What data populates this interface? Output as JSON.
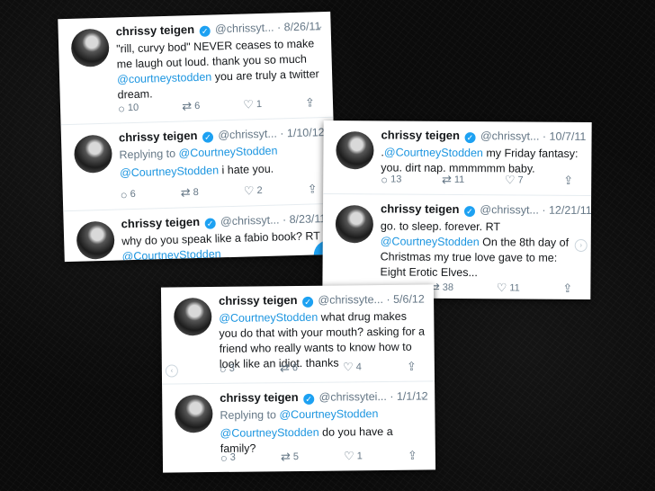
{
  "colors": {
    "accent": "#1da1f2",
    "link": "#1b95e0"
  },
  "card1": {
    "tweets": [
      {
        "name": "chrissy teigen",
        "handle": "@chrissyt...",
        "date": "· 8/26/11",
        "text1": "\"rill, curvy bod\" NEVER ceases to make me laugh out loud. thank you so much ",
        "mention": "@courtneystodden",
        "text2": " you are truly a twitter dream.",
        "replies": "10",
        "retweets": "6",
        "likes": "1"
      },
      {
        "name": "chrissy teigen",
        "handle": "@chrissyt...",
        "date": "· 1/10/12",
        "replying_prefix": "Replying to ",
        "replying_handle": "@CourtneyStodden",
        "mention": "@CourtneyStodden",
        "text2": " i hate you.",
        "replies": "6",
        "retweets": "8",
        "likes": "2"
      },
      {
        "name": "chrissy teigen",
        "handle": "@chrissyt...",
        "date": "· 8/23/11",
        "text1": "why do you speak like a fabio book? RT ",
        "mention": "@CourtneyStodden"
      }
    ]
  },
  "card2": {
    "tweets": [
      {
        "name": "chrissy teigen",
        "handle": "@chrissyt...",
        "date": "· 10/7/11",
        "text1": ".",
        "mention": "@CourtneyStodden",
        "text2": " my Friday fantasy: you. dirt nap. mmmmmm baby.",
        "replies": "13",
        "retweets": "11",
        "likes": "7"
      },
      {
        "name": "chrissy teigen",
        "handle": "@chrissyt...",
        "date": "· 12/21/11",
        "text1": "go. to sleep. forever. RT ",
        "mention": "@CourtneyStodden",
        "text2": " On the 8th day of Christmas my true love gave to me: Eight Erotic Elves...",
        "retweets": "38",
        "likes": "11"
      }
    ]
  },
  "card3": {
    "tweets": [
      {
        "name": "chrissy teigen",
        "handle": "@chrissyte...",
        "date": "· 5/6/12",
        "mention": "@CourtneyStodden",
        "text2": " what drug makes you do that with your mouth? asking for a friend who really wants to know how to look like an idiot. thanks",
        "replies": "3",
        "retweets": "6",
        "likes": "4"
      },
      {
        "name": "chrissy teigen",
        "handle": "@chrissytei...",
        "date": "· 1/1/12",
        "replying_prefix": "Replying to ",
        "replying_handle": "@CourtneyStodden",
        "mention": "@CourtneyStodden",
        "text2": " do you have a family?",
        "replies": "3",
        "retweets": "5",
        "likes": "1"
      }
    ]
  },
  "icons": {
    "reply": "reply-icon",
    "retweet": "retweet-icon",
    "like": "heart-icon",
    "share": "share-icon",
    "verified": "verified-badge-icon",
    "compose": "compose-icon"
  }
}
